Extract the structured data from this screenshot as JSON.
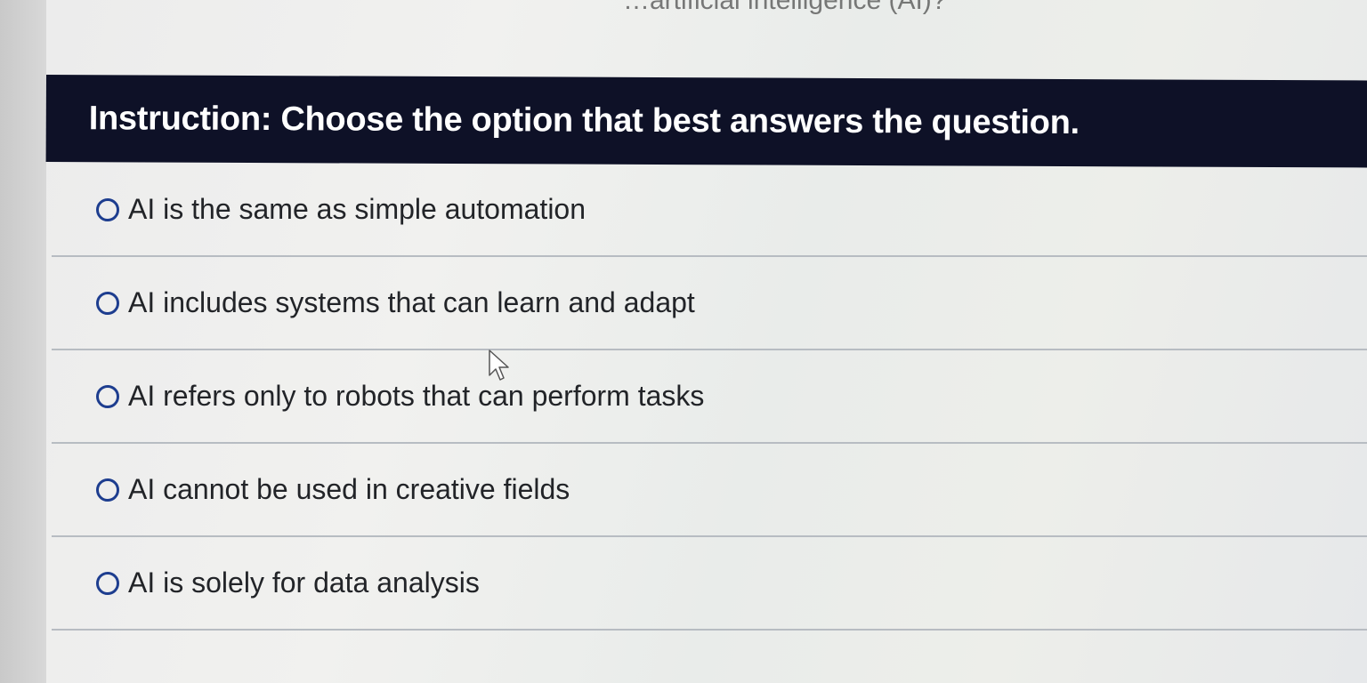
{
  "question": {
    "partial_text": "…artificial intelligence (AI)?"
  },
  "header": {
    "instruction": "Instruction: Choose the option that best answers the question."
  },
  "options": [
    {
      "label": "AI is the same as simple automation",
      "selected": false
    },
    {
      "label": "AI includes systems that can learn and adapt",
      "selected": false
    },
    {
      "label": "AI refers only to robots that can perform tasks",
      "selected": false
    },
    {
      "label": "AI cannot be used in creative fields",
      "selected": false
    },
    {
      "label": "AI is solely for data analysis",
      "selected": false
    }
  ],
  "colors": {
    "header_background": "#0e1127",
    "radio_border": "#1d3d8f",
    "divider": "#b7bcc2"
  },
  "icons": {
    "pointer": "mouse-pointer-icon",
    "radio": "radio-unchecked-icon"
  }
}
